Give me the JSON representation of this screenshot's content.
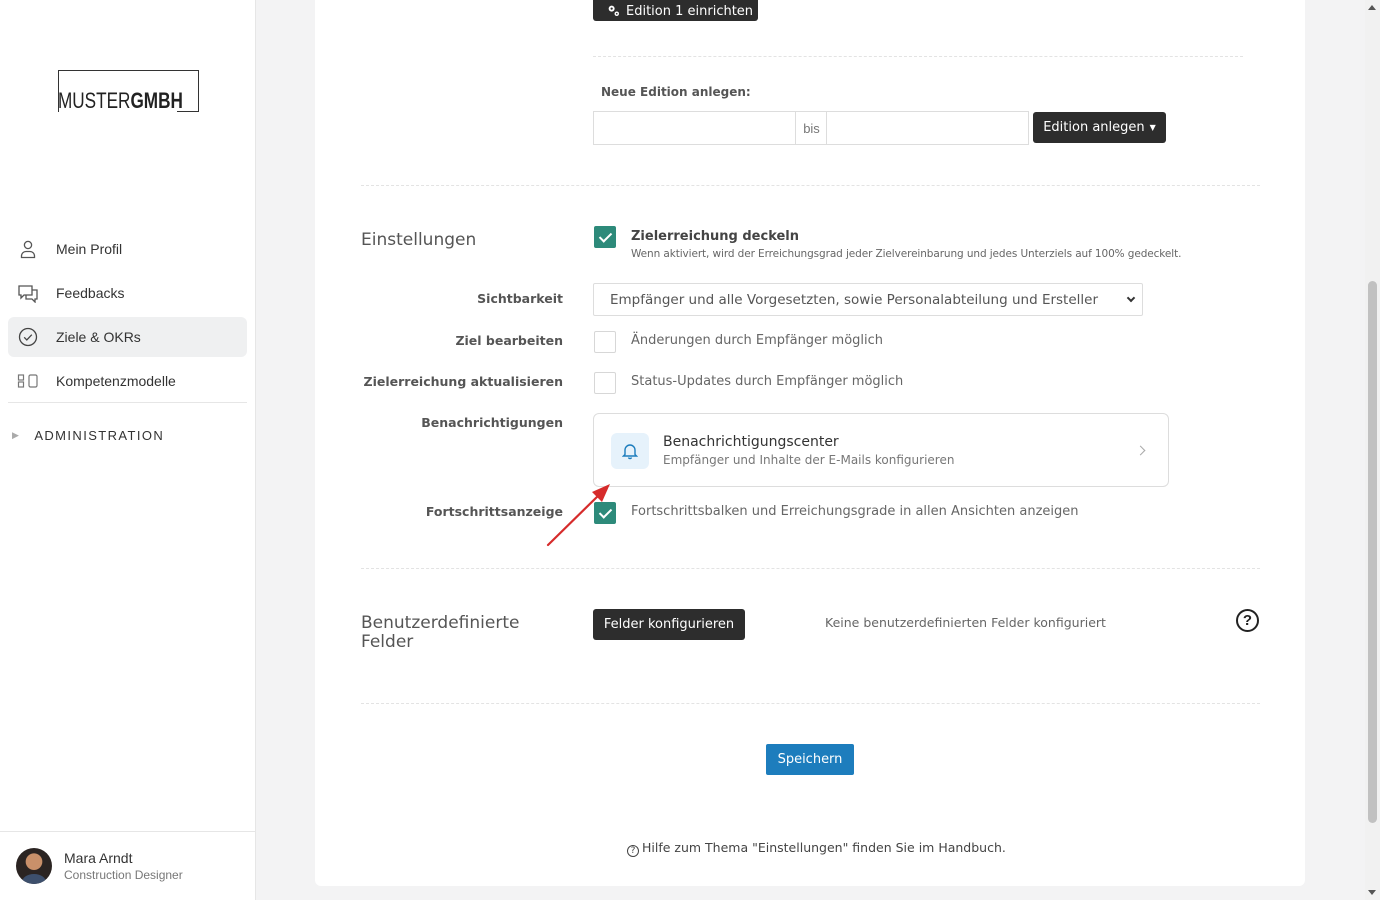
{
  "sidebar": {
    "logo_thin": "MUSTER",
    "logo_bold": "GMBH",
    "nav": [
      {
        "label": "Mein Profil",
        "icon": "user-icon"
      },
      {
        "label": "Feedbacks",
        "icon": "chat-bubbles-icon"
      },
      {
        "label": "Ziele & OKRs",
        "icon": "check-circle-icon",
        "active": true
      },
      {
        "label": "Kompetenzmodelle",
        "icon": "competency-model-icon"
      }
    ],
    "admin_label": "ADMINISTRATION",
    "user": {
      "name": "Mara Arndt",
      "role": "Construction Designer"
    }
  },
  "edition": {
    "setup_label": "Edition 1 einrichten",
    "new_label": "Neue Edition anlegen:",
    "from_value": "",
    "bis_label": "bis",
    "to_value": "",
    "create_label": "Edition anlegen"
  },
  "settings": {
    "title": "Einstellungen",
    "cap": {
      "checked": true,
      "title": "Zielerreichung deckeln",
      "desc": "Wenn aktiviert, wird der Erreichungsgrad jeder Zielvereinbarung und jedes Unterziels auf 100% gedeckelt."
    },
    "visibility": {
      "label": "Sichtbarkeit",
      "value": "Empfänger und alle Vorgesetzten, sowie Personalabteilung und Ersteller"
    },
    "edit_goal": {
      "label": "Ziel bearbeiten",
      "checked": false,
      "text": "Änderungen durch Empfänger möglich"
    },
    "update_progress": {
      "label": "Zielerreichung aktualisieren",
      "checked": false,
      "text": "Status-Updates durch Empfänger möglich"
    },
    "notifications": {
      "label": "Benachrichtigungen",
      "title": "Benachrichtigungscenter",
      "subtitle": "Empfänger und Inhalte der E-Mails konfigurieren"
    },
    "progress_display": {
      "label": "Fortschrittsanzeige",
      "checked": true,
      "text": "Fortschrittsbalken und Erreichungsgrade in allen Ansichten anzeigen"
    }
  },
  "custom_fields": {
    "title_line1": "Benutzerdefinierte",
    "title_line2": "Felder",
    "button_label": "Felder konfigurieren",
    "empty_text": "Keine benutzerdefinierten Felder konfiguriert",
    "help_glyph": "?"
  },
  "footer": {
    "save_label": "Speichern",
    "help_text": "Hilfe zum Thema \"Einstellungen\" finden Sie im Handbuch.",
    "help_glyph": "?"
  },
  "colors": {
    "accent_teal": "#2d8a7a",
    "primary_blue": "#1d7dbd",
    "dark_button": "#2d2d2d",
    "annotation_red": "#d62b2b"
  }
}
